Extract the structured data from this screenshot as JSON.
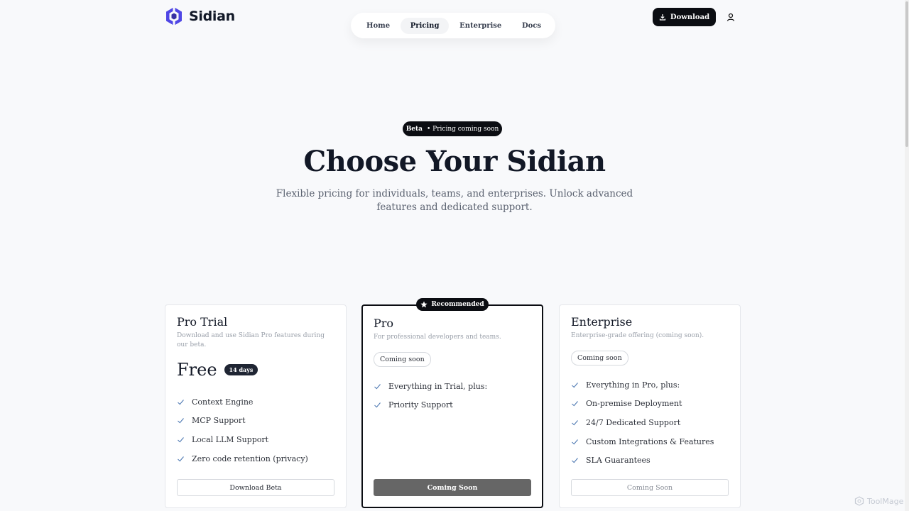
{
  "brand": {
    "name": "Sidian",
    "accent": "#4f46e5"
  },
  "nav": {
    "items": [
      {
        "label": "Home"
      },
      {
        "label": "Pricing",
        "active": true
      },
      {
        "label": "Enterprise"
      },
      {
        "label": "Docs"
      }
    ]
  },
  "header": {
    "download_label": "Download",
    "user_icon": "user-icon",
    "download_icon": "download-icon"
  },
  "hero": {
    "badge_strong": "Beta",
    "badge_text": "• Pricing coming soon",
    "title": "Choose Your Sidian",
    "subtitle": "Flexible pricing for individuals, teams, and enterprises. Unlock advanced features and dedicated support."
  },
  "plans": [
    {
      "name": "Pro Trial",
      "description": "Download and use Sidian Pro features during our beta.",
      "price": "Free",
      "price_badge": "14 days",
      "features": [
        "Context Engine",
        "MCP Support",
        "Local LLM Support",
        "Zero code retention (privacy)"
      ],
      "button": "Download Beta"
    },
    {
      "name": "Pro",
      "badge": "Recommended",
      "description": "For professional developers and teams.",
      "status": "Coming soon",
      "features": [
        "Everything in Trial, plus:",
        "Priority Support"
      ],
      "button": "Coming Soon"
    },
    {
      "name": "Enterprise",
      "description": "Enterprise-grade offering (coming soon).",
      "status": "Coming soon",
      "features": [
        "Everything in Pro, plus:",
        "On-premise Deployment",
        "24/7 Dedicated Support",
        "Custom Integrations & Features",
        "SLA Guarantees"
      ],
      "button": "Coming Soon"
    }
  ],
  "watermark": "ToolMage"
}
